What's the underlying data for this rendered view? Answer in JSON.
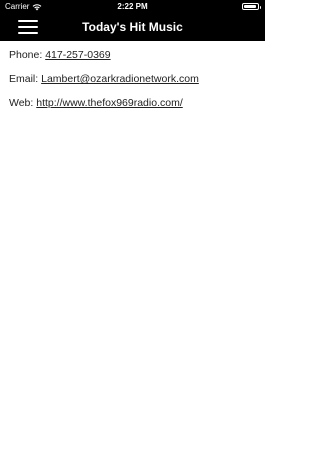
{
  "status_bar": {
    "carrier": "Carrier",
    "wifi_icon": "wifi-icon",
    "time": "2:22 PM",
    "battery_icon": "battery-icon"
  },
  "nav": {
    "menu_icon": "hamburger-menu-icon",
    "title": "Today's Hit Music"
  },
  "contact": {
    "phone_label": "Phone:",
    "phone_value": "417-257-0369",
    "email_label": "Email:",
    "email_value": "Lambert@ozarkradionetwork.com",
    "web_label": "Web:",
    "web_value": "http://www.thefox969radio.com/"
  },
  "colors": {
    "header_bg": "#000000",
    "header_text": "#ffffff",
    "body_bg": "#ffffff",
    "body_text": "#222222"
  }
}
